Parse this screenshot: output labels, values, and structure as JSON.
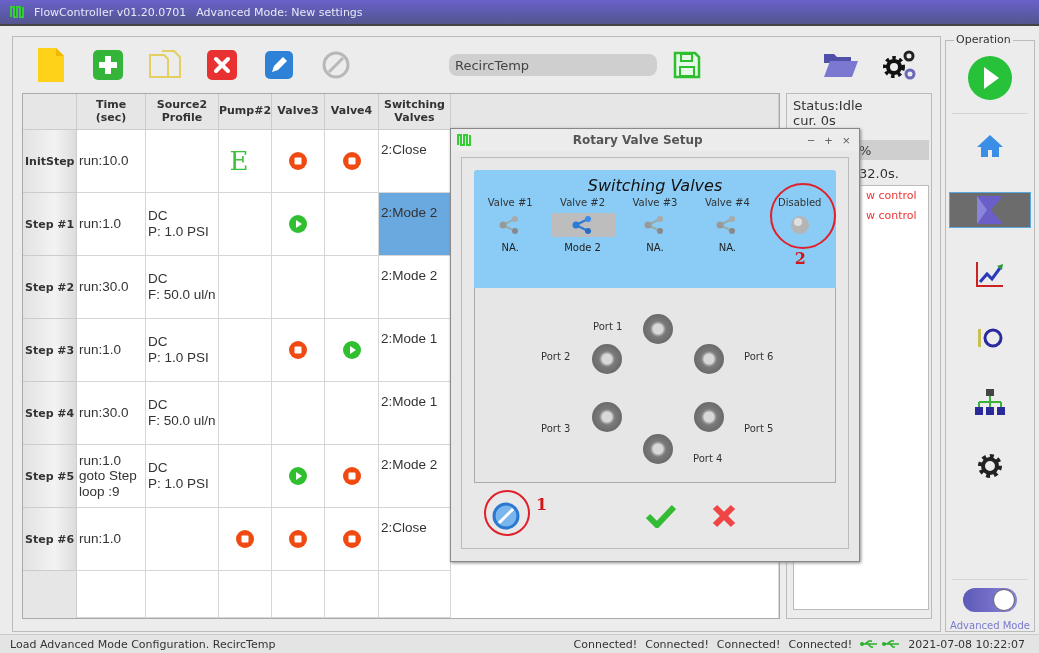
{
  "window": {
    "title": "FlowController v01.20.0701",
    "mode": "Advanced Mode: New settings"
  },
  "toolbar": {
    "tools": [
      {
        "kind": "new"
      },
      {
        "kind": "add"
      },
      {
        "kind": "copy"
      },
      {
        "kind": "delete"
      },
      {
        "kind": "edit"
      },
      {
        "kind": "disable"
      }
    ],
    "config_name": {
      "value": "RecircTemp"
    }
  },
  "table": {
    "columns": [
      "Time\n(sec)",
      "Source2\nProfile",
      "Pump#2",
      "Valve3",
      "Valve4",
      "Switching\nValves"
    ],
    "rows": [
      {
        "step": "InitStep",
        "time": "run:10.0",
        "pump": {
          "kind": "letter",
          "text": "E"
        },
        "valve3": {
          "kind": "stop"
        },
        "valve4": {
          "kind": "stop"
        },
        "switching": {
          "text": "2:Close",
          "selected": false
        }
      },
      {
        "step": "Step #1",
        "time": "run:1.0",
        "source": "DC\nP: 1.0 PSI",
        "valve3": {
          "kind": "run"
        },
        "switching": {
          "text": "2:Mode 2",
          "selected": true
        }
      },
      {
        "step": "Step #2",
        "time": "run:30.0",
        "source": "DC\nF: 50.0 ul/n",
        "switching": {
          "text": "2:Mode 2",
          "selected": false
        }
      },
      {
        "step": "Step #3",
        "time": "run:1.0",
        "source": "DC\nP: 1.0 PSI",
        "valve3": {
          "kind": "stop"
        },
        "valve4": {
          "kind": "run"
        },
        "switching": {
          "text": "2:Mode 1",
          "selected": false
        }
      },
      {
        "step": "Step #4",
        "time": "run:30.0",
        "source": "DC\nF: 50.0 ul/n",
        "switching": {
          "text": "2:Mode 1",
          "selected": false
        }
      },
      {
        "step": "Step #5",
        "time": "run:1.0\ngoto Step\nloop :9",
        "source": "DC\nP: 1.0 PSI",
        "valve3": {
          "kind": "run"
        },
        "valve4": {
          "kind": "stop"
        },
        "switching": {
          "text": "2:Mode 2",
          "selected": false
        }
      },
      {
        "step": "Step #6",
        "time": "run:1.0",
        "pump": {
          "kind": "stop"
        },
        "valve3": {
          "kind": "stop"
        },
        "valve4": {
          "kind": "stop"
        },
        "switching": {
          "text": "2:Close",
          "selected": false
        }
      }
    ]
  },
  "status_panel": {
    "status": "Status:Idle",
    "current": "cur. 0s",
    "progress_text": "%",
    "remaining": "32.0s.",
    "log": [
      "w control",
      "w control"
    ]
  },
  "dialog": {
    "title": "Rotary Valve Setup",
    "controls": [
      "−",
      "+",
      "×"
    ],
    "heading": "Switching Valves",
    "valves": [
      {
        "label": "Valve #1",
        "mode": "NA.",
        "selected": false
      },
      {
        "label": "Valve #2",
        "mode": "Mode 2",
        "selected": true
      },
      {
        "label": "Valve #3",
        "mode": "NA.",
        "selected": false
      },
      {
        "label": "Valve #4",
        "mode": "NA.",
        "selected": false
      }
    ],
    "disabled": {
      "label": "Disabled",
      "annotation": "2"
    },
    "ports": [
      "Port 1",
      "Port 2",
      "Port 3",
      "Port 4",
      "Port 5",
      "Port 6"
    ],
    "disable_button": {
      "annotation": "1"
    }
  },
  "operation": {
    "title": "Operation",
    "nav": [
      {
        "kind": "home",
        "selected": false
      },
      {
        "kind": "flow",
        "selected": true
      },
      {
        "kind": "chart",
        "selected": false
      },
      {
        "kind": "io",
        "selected": false
      },
      {
        "kind": "network",
        "selected": false
      },
      {
        "kind": "settings",
        "selected": false
      }
    ],
    "advanced_mode": {
      "label": "Advanced Mode",
      "on": true
    }
  },
  "status_bar": {
    "message": "Load Advanced Mode Configuration. RecircTemp",
    "connections": [
      "Connected!",
      "Connected!",
      "Connected!",
      "Connected!"
    ],
    "datetime": "2021-07-08 10:22:07"
  }
}
